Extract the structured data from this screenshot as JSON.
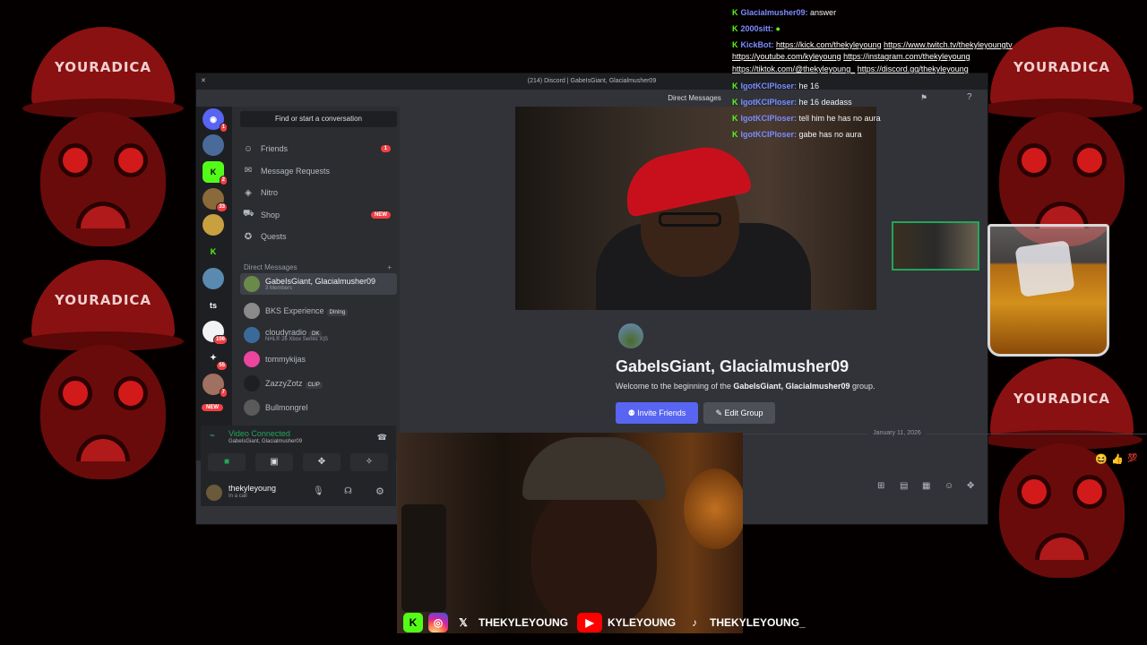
{
  "background": {
    "logo_text": "YOURADICA"
  },
  "window": {
    "title": "(214) Discord | GabeIsGiant, Glacialmusher09"
  },
  "servers": [
    {
      "name": "discord-home",
      "badge": "1",
      "color": "#5865f2",
      "glyph": "◉"
    },
    {
      "name": "server-avatar",
      "badge": "",
      "color": "#4a6a9a",
      "glyph": ""
    },
    {
      "name": "kick-server",
      "badge": "2",
      "color": "#53fc18",
      "glyph": "K"
    },
    {
      "name": "server-2",
      "badge": "33",
      "color": "#8a6a3a",
      "glyph": ""
    },
    {
      "name": "server-3",
      "badge": "",
      "color": "#c8a040",
      "glyph": ""
    },
    {
      "name": "kick-server-2",
      "badge": "",
      "color": "#1e1f22",
      "glyph": "K"
    },
    {
      "name": "server-4",
      "badge": "",
      "color": "#5a8ab0",
      "glyph": ""
    },
    {
      "name": "server-ts",
      "badge": "",
      "color": "#1e1f22",
      "glyph": "ts"
    },
    {
      "name": "server-5",
      "badge": "106",
      "color": "#f2f3f5",
      "glyph": ""
    },
    {
      "name": "server-6",
      "badge": "55",
      "color": "#1e1f22",
      "glyph": "✦"
    },
    {
      "name": "server-7",
      "badge": "7",
      "color": "#a07060",
      "glyph": ""
    }
  ],
  "new_label": "NEW",
  "search": {
    "placeholder": "Find or start a conversation"
  },
  "nav": [
    {
      "label": "Friends",
      "badge": "1"
    },
    {
      "label": "Message Requests",
      "badge": ""
    },
    {
      "label": "Nitro",
      "badge": ""
    },
    {
      "label": "Shop",
      "badge": "NEW"
    },
    {
      "label": "Quests",
      "badge": ""
    }
  ],
  "dm_header": "Direct Messages",
  "dms": [
    {
      "name": "GabeIsGiant, Glacialmusher09",
      "sub": "3 Members",
      "tag": "",
      "color": "#6a8a4a"
    },
    {
      "name": "BKS Experience",
      "sub": "",
      "tag": "DInIng",
      "color": "#8a8a8a"
    },
    {
      "name": "cloudyradio",
      "sub": "NHL® 26 Xbox Series X|S",
      "tag": "DK",
      "color": "#3a6a9a"
    },
    {
      "name": "tommykijas",
      "sub": "",
      "tag": "",
      "color": "#eb459e"
    },
    {
      "name": "ZazzyZotz",
      "sub": "",
      "tag": "CLIP",
      "color": "#1e1f22"
    },
    {
      "name": "Bullmongrel",
      "sub": "",
      "tag": "",
      "color": "#5a5a5a"
    }
  ],
  "voice": {
    "status": "Video Connected",
    "channel": "GabeIsGiant, Glacialmusher09"
  },
  "user": {
    "name": "thekyleyoung",
    "status": "In a call"
  },
  "main": {
    "header": "Direct Messages",
    "group_title": "GabeIsGiant, Glacialmusher09",
    "desc_prefix": "Welcome to the beginning of the ",
    "desc_bold": "GabeIsGiant, Glacialmusher09",
    "desc_suffix": " group.",
    "invite_label": "Invite Friends",
    "edit_label": "Edit Group",
    "date": "January 11, 2026"
  },
  "chat": [
    {
      "user": "Glacialmusher09:",
      "text": "answer",
      "links": []
    },
    {
      "user": "2000sitt:",
      "text": "",
      "links": []
    },
    {
      "user": "KickBot:",
      "text": "",
      "links": [
        "https://kick.com/thekyleyoung",
        "https://www.twitch.tv/thekyleyoungtv"
      ]
    },
    {
      "user": "",
      "text": "",
      "links": [
        "https://youtube.com/kyleyoung",
        "https://instagram.com/thekyleyoung"
      ]
    },
    {
      "user": "",
      "text": "",
      "links": [
        "https://tiktok.com/@thekyleyoung_",
        "https://discord.gg/thekyleyoung"
      ]
    },
    {
      "user": "IgotKCIPloser:",
      "text": "he 16",
      "links": []
    },
    {
      "user": "IgotKCIPloser:",
      "text": "he 16 deadass",
      "links": []
    },
    {
      "user": "IgotKCIPloser:",
      "text": "tell him he has no aura",
      "links": []
    },
    {
      "user": "IgotKCIPloser:",
      "text": "gabe has no aura",
      "links": []
    }
  ],
  "socials": [
    {
      "handle": "THEKYLEYOUNG",
      "icon": "x-icon"
    },
    {
      "handle": "KYLEYOUNG",
      "icon": "youtube-icon"
    },
    {
      "handle": "THEKYLEYOUNG_",
      "icon": "tiktok-icon"
    }
  ],
  "colors": {
    "discord_bg": "#313338",
    "sidebar_bg": "#2b2d31",
    "accent": "#5865f2",
    "green": "#23a55a",
    "kick_green": "#53fc18",
    "bg_red": "#8a1111"
  }
}
